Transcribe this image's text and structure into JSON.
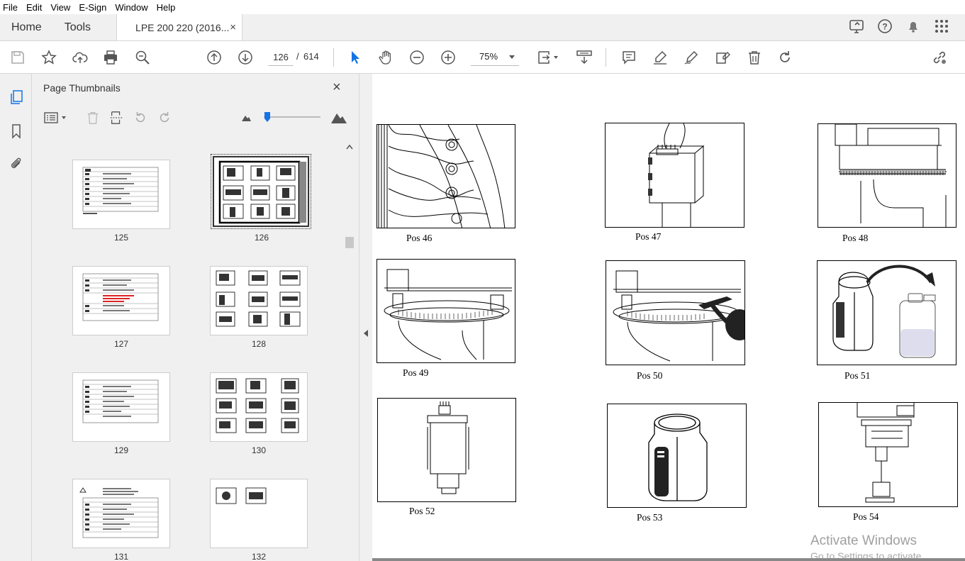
{
  "menu": [
    "File",
    "Edit",
    "View",
    "E-Sign",
    "Window",
    "Help"
  ],
  "tabs": {
    "home": "Home",
    "tools": "Tools",
    "doc": "LPE 200 220 (2016...",
    "close": "×"
  },
  "toolbar": {
    "page_current": "126",
    "page_sep": "/",
    "page_total": "614",
    "zoom": "75%"
  },
  "panel": {
    "title": "Page Thumbnails",
    "close": "×"
  },
  "thumbnails": [
    {
      "label": "125",
      "kind": "table"
    },
    {
      "label": "126",
      "kind": "figures",
      "selected": true
    },
    {
      "label": "127",
      "kind": "table"
    },
    {
      "label": "128",
      "kind": "figures"
    },
    {
      "label": "129",
      "kind": "table"
    },
    {
      "label": "130",
      "kind": "figures"
    },
    {
      "label": "131",
      "kind": "table"
    },
    {
      "label": "132",
      "kind": "figures-partial"
    }
  ],
  "figures": [
    {
      "caption": "Pos 46"
    },
    {
      "caption": "Pos 47"
    },
    {
      "caption": "Pos 48"
    },
    {
      "caption": "Pos 49"
    },
    {
      "caption": "Pos 50"
    },
    {
      "caption": "Pos 51"
    },
    {
      "caption": "Pos 52"
    },
    {
      "caption": "Pos 53"
    },
    {
      "caption": "Pos 54"
    }
  ],
  "watermark": {
    "line1": "Activate Windows",
    "line2": "Go to Settings to activate Windows."
  },
  "colors": {
    "accent": "#1473e6",
    "toolbar_bg": "#ffffff",
    "chrome_bg": "#f0f0f0"
  }
}
